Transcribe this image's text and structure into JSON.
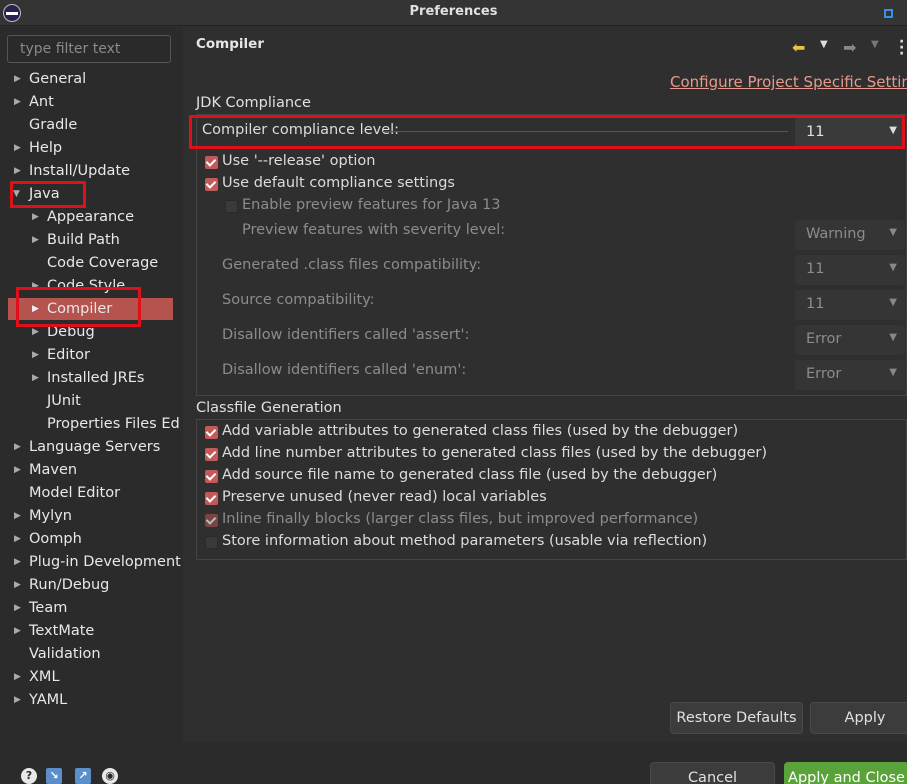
{
  "window": {
    "title": "Preferences"
  },
  "filter": {
    "placeholder": "type filter text"
  },
  "tree": {
    "general": "General",
    "ant": "Ant",
    "gradle": "Gradle",
    "help": "Help",
    "install_update": "Install/Update",
    "java": "Java",
    "appearance": "Appearance",
    "build_path": "Build Path",
    "code_coverage": "Code Coverage",
    "code_style": "Code Style",
    "compiler": "Compiler",
    "debug": "Debug",
    "editor": "Editor",
    "installed_jres": "Installed JREs",
    "junit": "JUnit",
    "properties_files": "Properties Files Ed",
    "language_servers": "Language Servers",
    "maven": "Maven",
    "model_editor": "Model Editor",
    "mylyn": "Mylyn",
    "oomph": "Oomph",
    "plugin_dev": "Plug-in Development",
    "run_debug": "Run/Debug",
    "team": "Team",
    "textmate": "TextMate",
    "validation": "Validation",
    "xml": "XML",
    "yaml": "YAML"
  },
  "page": {
    "title": "Compiler",
    "configure_link": "Configure Project Specific Settings..."
  },
  "jdk": {
    "group_title": "JDK Compliance",
    "compliance_label": "Compiler compliance level:",
    "compliance_value": "11",
    "release_option": "Use '--release' option",
    "default_settings": "Use default compliance settings",
    "enable_preview": "Enable preview features for Java 13",
    "preview_severity_label": "Preview features with severity level:",
    "preview_severity_value": "Warning",
    "generated_label": "Generated .class files compatibility:",
    "generated_value": "11",
    "source_label": "Source compatibility:",
    "source_value": "11",
    "assert_label": "Disallow identifiers called 'assert':",
    "assert_value": "Error",
    "enum_label": "Disallow identifiers called 'enum':",
    "enum_value": "Error"
  },
  "classfile": {
    "group_title": "Classfile Generation",
    "variable_attrs": "Add variable attributes to generated class files (used by the debugger)",
    "line_number_attrs": "Add line number attributes to generated class files (used by the debugger)",
    "source_file_name": "Add source file name to generated class file (used by the debugger)",
    "preserve_unused": "Preserve unused (never read) local variables",
    "inline_finally": "Inline finally blocks (larger class files, but improved performance)",
    "method_params": "Store information about method parameters (usable via reflection)"
  },
  "buttons": {
    "restore_defaults": "Restore Defaults",
    "apply": "Apply",
    "cancel": "Cancel",
    "apply_close": "Apply and Close"
  },
  "colors": {
    "selection": "#b5534e",
    "highlight_box": "#e0101a",
    "primary_button": "#5aa23a",
    "link": "#e79a8c"
  }
}
